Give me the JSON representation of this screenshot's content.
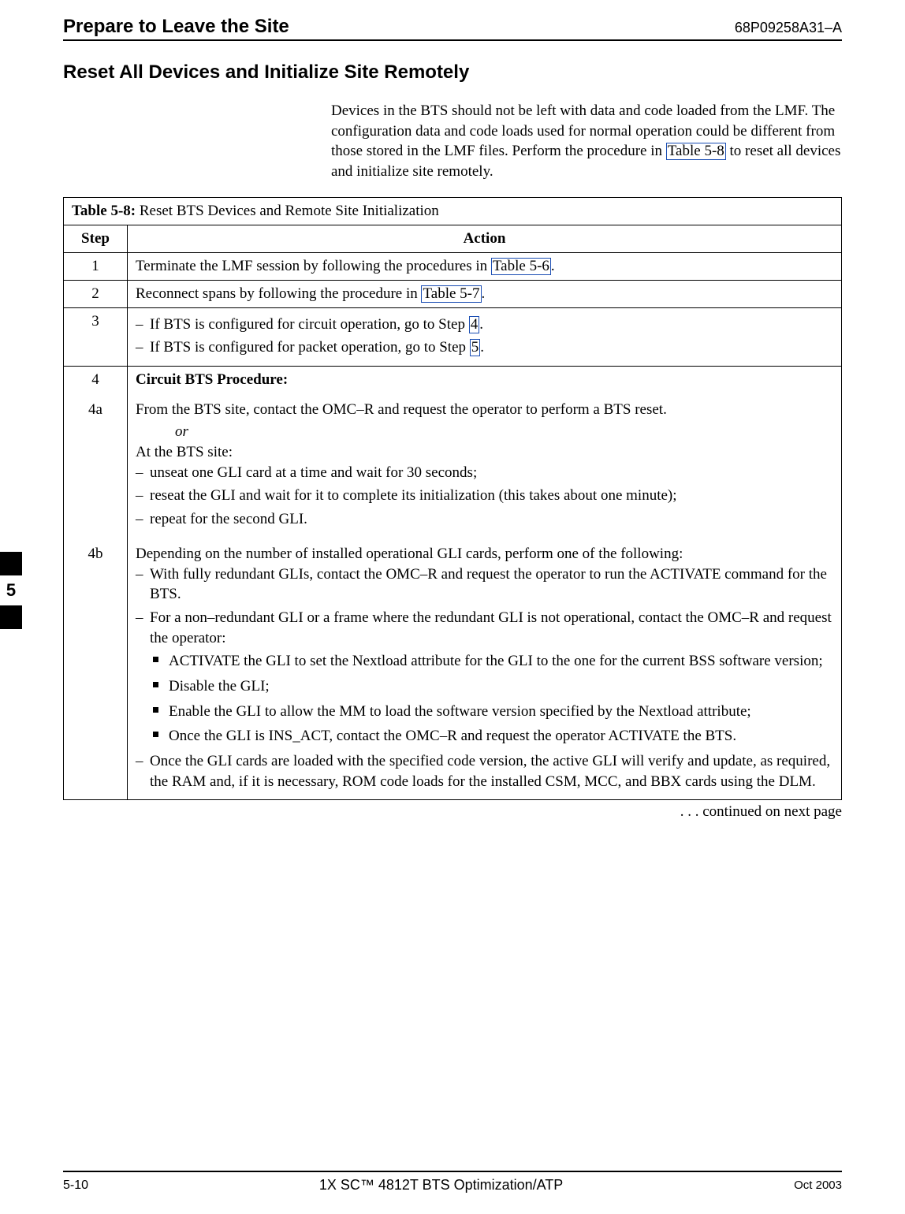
{
  "header": {
    "title": "Prepare to Leave the Site",
    "doc_id": "68P09258A31–A"
  },
  "section_title": "Reset All Devices and Initialize Site Remotely",
  "intro": {
    "pre": "Devices in the BTS should not be left with data and code loaded from the LMF. The configuration data and code loads used for normal operation could be different from those stored in the LMF files. Perform the procedure in ",
    "link": "Table 5-8",
    "post": " to reset all devices and initialize site remotely."
  },
  "table": {
    "title_bold": "Table 5-8:",
    "title_rest": " Reset BTS Devices and Remote Site Initialization",
    "header_step": "Step",
    "header_action": "Action",
    "row1": {
      "step": "1",
      "pre": "Terminate the LMF session by following the procedures in ",
      "link": "Table 5-6",
      "post": "."
    },
    "row2": {
      "step": "2",
      "pre": "Reconnect spans by following the procedure in ",
      "link": "Table 5-7",
      "post": "."
    },
    "row3": {
      "step": "3",
      "li1_pre": "If BTS is configured for circuit operation, go to Step ",
      "li1_link": "4",
      "li1_post": ".",
      "li2_pre": "If BTS is configured for packet operation, go to Step ",
      "li2_link": "5",
      "li2_post": "."
    },
    "row4": {
      "step": "4",
      "title": "Circuit BTS Procedure:"
    },
    "row4a": {
      "step": "4a",
      "line1": "From the BTS site, contact the OMC–R and request the operator to perform a BTS reset.",
      "or": "or",
      "line2": "At the BTS site:",
      "d1": "unseat one GLI card at a time and wait for 30 seconds;",
      "d2": "reseat the GLI and wait for it to complete its initialization (this takes about one minute);",
      "d3": "repeat for the second GLI."
    },
    "row4b": {
      "step": "4b",
      "line1": "Depending on the number of installed operational GLI cards, perform one of the following:",
      "d1": "With fully redundant GLIs, contact the OMC–R and request the operator to run the ACTIVATE command for the BTS.",
      "d2": "For a non–redundant GLI or a frame where the redundant GLI is not operational, contact the OMC–R and request the operator:",
      "b1": "ACTIVATE the GLI to set the Nextload attribute for the GLI to the one for the current BSS software version;",
      "b2": "Disable the GLI;",
      "b3": "Enable the GLI to allow the MM to load the software version specified by the Nextload attribute;",
      "b4": "Once the GLI is INS_ACT, contact the OMC–R and request the operator ACTIVATE the BTS.",
      "d3": "Once the GLI cards are loaded with the specified code version, the active GLI will verify and update, as required, the RAM and, if it is necessary, ROM code loads for the installed CSM, MCC, and BBX cards using the DLM."
    }
  },
  "continued": ". . . continued on next page",
  "tab_num": "5",
  "footer": {
    "left": "5-10",
    "center": "1X SC™ 4812T BTS Optimization/ATP",
    "right": "Oct 2003"
  }
}
